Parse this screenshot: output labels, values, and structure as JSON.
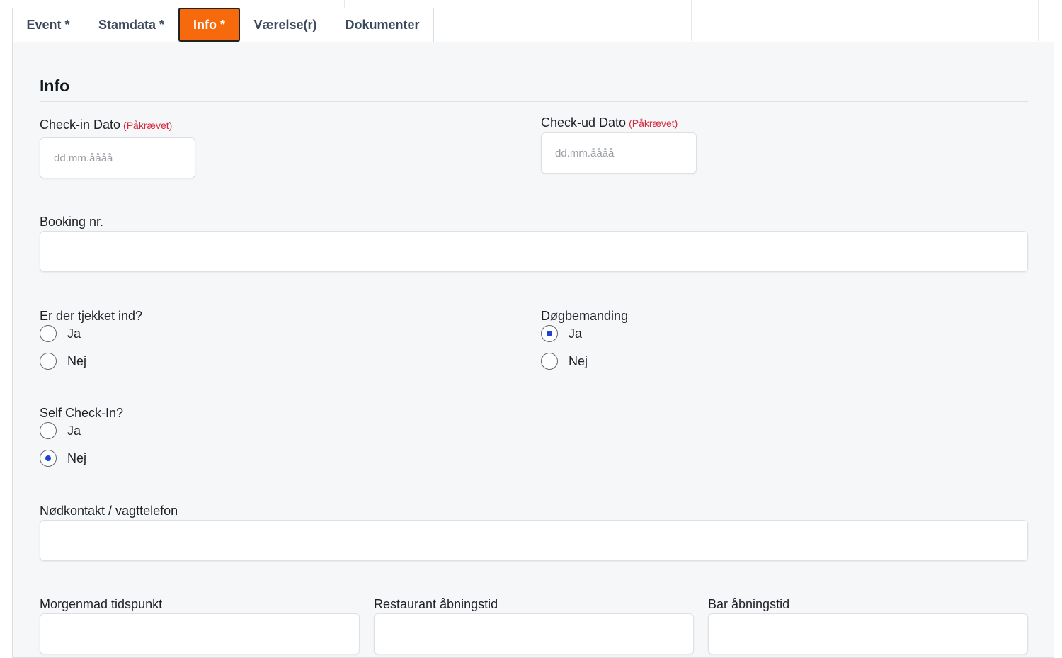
{
  "tabs": [
    {
      "label": "Event *",
      "active": false
    },
    {
      "label": "Stamdata *",
      "active": false
    },
    {
      "label": "Info *",
      "active": true
    },
    {
      "label": "Værelse(r)",
      "active": false
    },
    {
      "label": "Dokumenter",
      "active": false
    }
  ],
  "colors": {
    "active_tab": "#f7690d",
    "required": "#d4283b",
    "radio_checked": "#1f43d6",
    "panel_bg": "#f6f7f9"
  },
  "section": {
    "title": "Info"
  },
  "checkin": {
    "label": "Check-in Dato",
    "required": "(Påkrævet)",
    "placeholder": "dd.mm.åååå"
  },
  "checkout": {
    "label": "Check-ud Dato",
    "required": "(Påkrævet)",
    "placeholder": "dd.mm.åååå"
  },
  "booking": {
    "label": "Booking nr.",
    "value": ""
  },
  "checked_in": {
    "label": "Er der tjekket ind?",
    "options": [
      "Ja",
      "Nej"
    ],
    "selected": null
  },
  "staffing": {
    "label": "Døgbemanding",
    "options": [
      "Ja",
      "Nej"
    ],
    "selected": "Ja"
  },
  "self_checkin": {
    "label": "Self Check-In?",
    "options": [
      "Ja",
      "Nej"
    ],
    "selected": "Nej"
  },
  "emergency": {
    "label": "Nødkontakt / vagttelefon",
    "value": ""
  },
  "breakfast": {
    "label": "Morgenmad tidspunkt",
    "value": ""
  },
  "restaurant": {
    "label": "Restaurant åbningstid",
    "value": ""
  },
  "bar": {
    "label": "Bar åbningstid",
    "value": ""
  }
}
